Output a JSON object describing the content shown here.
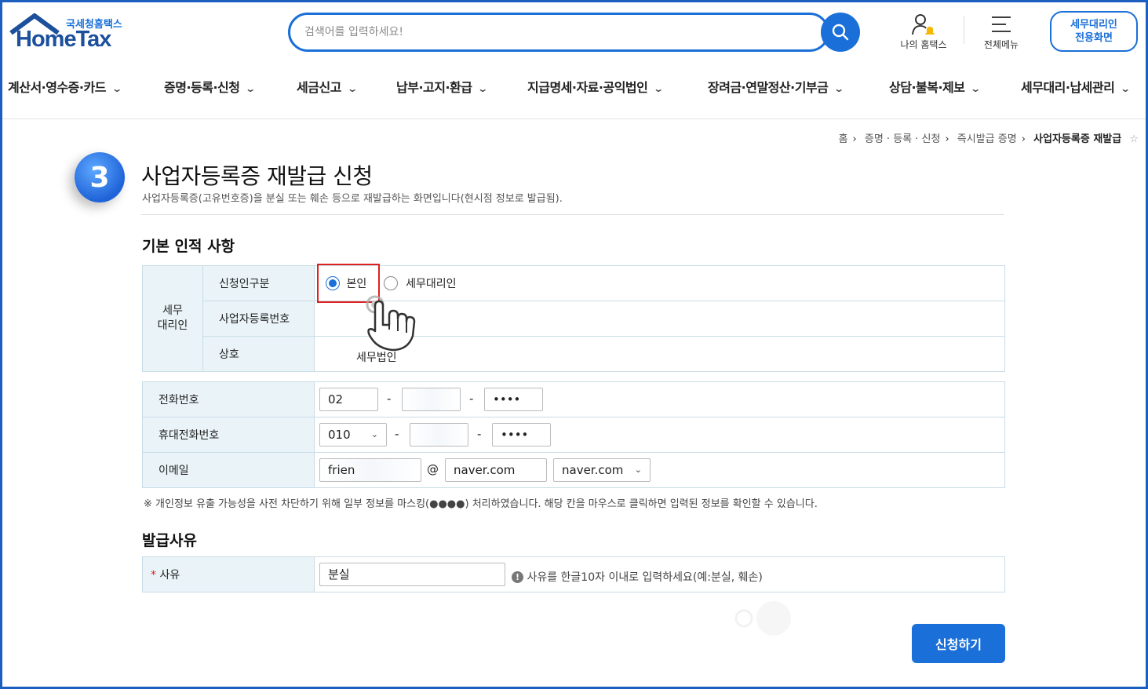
{
  "header": {
    "logo_kor": "국세청홈택스",
    "logo_eng": "HomeTax",
    "search_placeholder": "검색어를 입력하세요!",
    "my_hometax": "나의 홈택스",
    "all_menu": "전체메뉴",
    "tax_agent_btn_line1": "세무대리인",
    "tax_agent_btn_line2": "전용화면"
  },
  "gnb": [
    "계산서·영수증·카드",
    "증명·등록·신청",
    "세금신고",
    "납부·고지·환급",
    "지급명세·자료·공익법인",
    "장려금·연말정산·기부금",
    "상담·불복·제보",
    "세무대리·납세관리"
  ],
  "breadcrumb": {
    "home": "홈",
    "level1": "증명 · 등록 · 신청",
    "level2": "즉시발급 증명",
    "current": "사업자등록증 재발급"
  },
  "page": {
    "step": "3",
    "title": "사업자등록증 재발급 신청",
    "subtitle": "사업자등록증(고유번호증)을 분실 또는 훼손 등으로 재발급하는 화면입니다(현시점 정보로 발급됨)."
  },
  "basic": {
    "section_title": "기본 인적 사항",
    "group_label_1": "세무",
    "group_label_2": "대리인",
    "applicant_type_label": "신청인구분",
    "option_self": "본인",
    "option_agent": "세무대리인",
    "selected": "본인",
    "biz_no_label": "사업자등록번호",
    "biz_no_value": "",
    "company_label": "상호",
    "company_value": "세무법인"
  },
  "contact": {
    "phone_label": "전화번호",
    "phone_1": "02",
    "phone_2": "",
    "phone_3": "••••",
    "mobile_label": "휴대전화번호",
    "mobile_1": "010",
    "mobile_2": "",
    "mobile_3": "••••",
    "email_label": "이메일",
    "email_id": "frien",
    "at": "@",
    "email_domain": "naver.com",
    "email_select": "naver.com",
    "dash": "-"
  },
  "note": "※ 개인정보 유출 가능성을 사전 차단하기 위해 일부 정보를 마스킹(●●●●) 처리하였습니다. 해당 칸을 마우스로 클릭하면 입력된 정보를 확인할 수 있습니다.",
  "reason": {
    "section_title": "발급사유",
    "label_star": "*",
    "label": "사유",
    "value": "분실",
    "hint": "사유를 한글10자 이내로 입력하세요(예:분실, 훼손)"
  },
  "submit_label": "신청하기"
}
